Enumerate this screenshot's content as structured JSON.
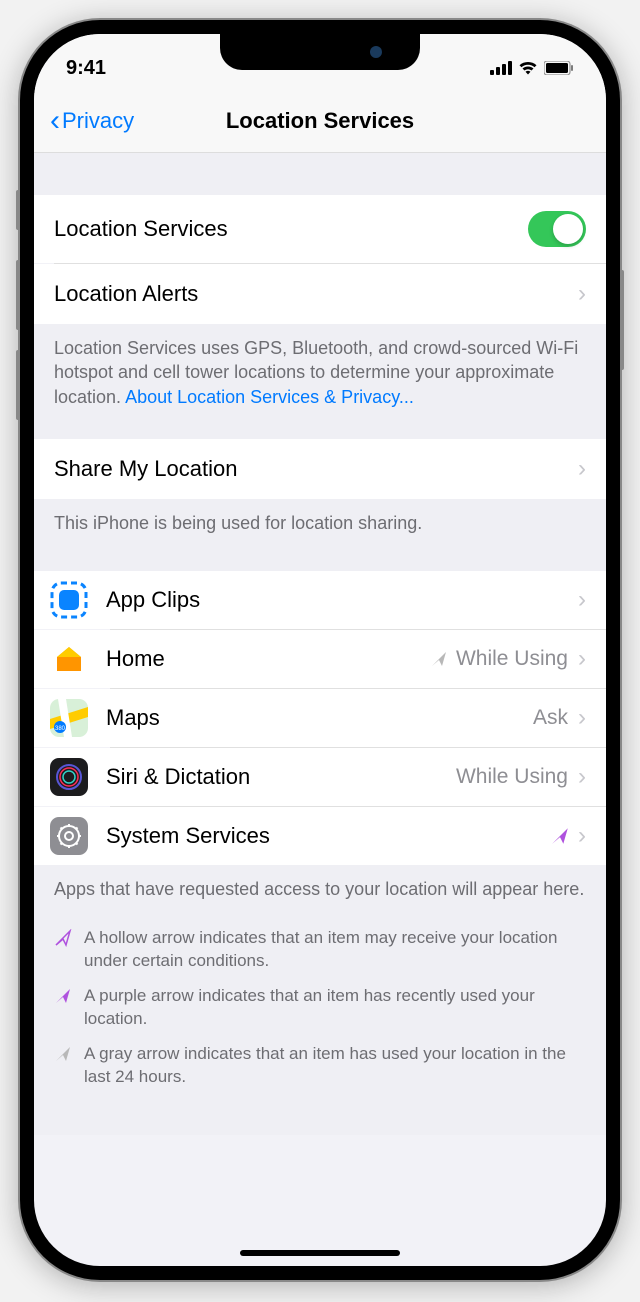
{
  "status": {
    "time": "9:41"
  },
  "nav": {
    "back_label": "Privacy",
    "title": "Location Services"
  },
  "rows": {
    "location_services": "Location Services",
    "location_alerts": "Location Alerts",
    "share_my_location": "Share My Location"
  },
  "footers": {
    "location_desc": "Location Services uses GPS, Bluetooth, and crowd-sourced Wi-Fi hotspot and cell tower locations to determine your approximate location. ",
    "location_link": "About Location Services & Privacy...",
    "share_desc": "This iPhone is being used for location sharing.",
    "apps_desc": "Apps that have requested access to your location will appear here."
  },
  "apps": [
    {
      "name": "App Clips",
      "value": "",
      "indicator": ""
    },
    {
      "name": "Home",
      "value": "While Using",
      "indicator": "gray"
    },
    {
      "name": "Maps",
      "value": "Ask",
      "indicator": ""
    },
    {
      "name": "Siri & Dictation",
      "value": "While Using",
      "indicator": ""
    },
    {
      "name": "System Services",
      "value": "",
      "indicator": "purple"
    }
  ],
  "legend": [
    {
      "type": "hollow",
      "text": "A hollow arrow indicates that an item may receive your location under certain conditions."
    },
    {
      "type": "purple",
      "text": "A purple arrow indicates that an item has recently used your location."
    },
    {
      "type": "gray",
      "text": "A gray arrow indicates that an item has used your location in the last 24 hours."
    }
  ]
}
